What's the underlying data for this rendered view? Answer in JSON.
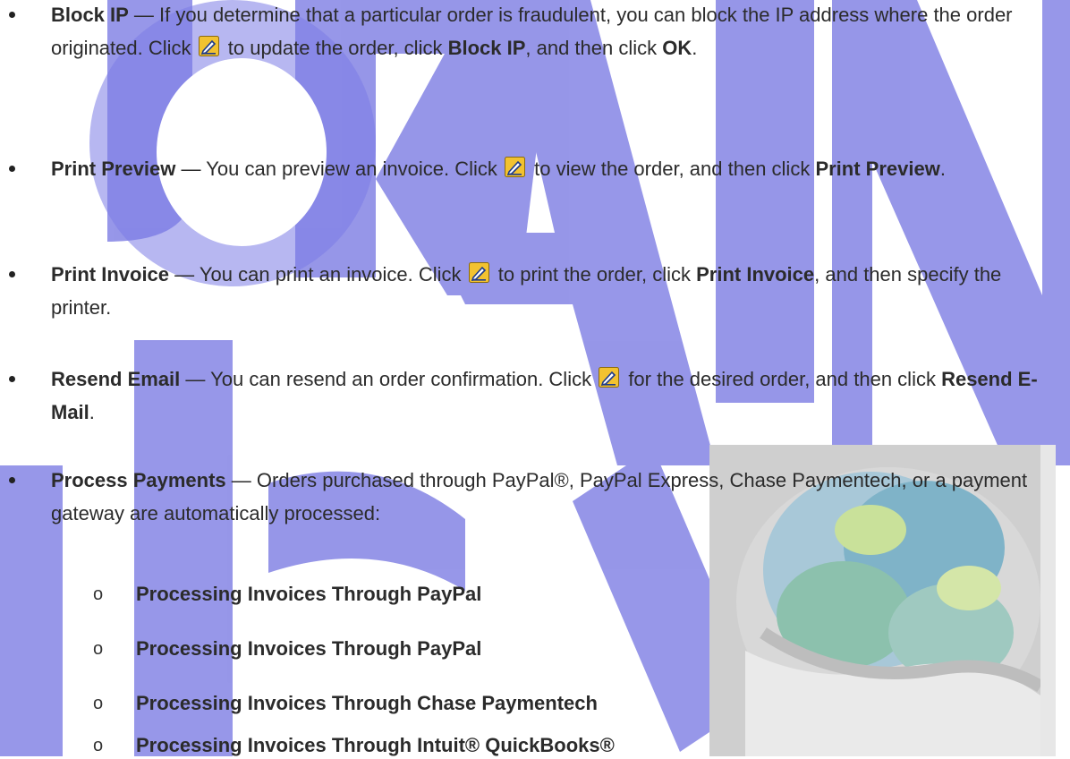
{
  "watermark": {
    "color": "#6666e6"
  },
  "edit_icon": {
    "icon": "pencil-edit-icon",
    "colors": {
      "bg": "#f2c230",
      "border": "#8a6a10",
      "pencil": "#1d3a8a"
    }
  },
  "items": [
    {
      "term": "Block IP",
      "dash": " — ",
      "text_before_icon": "If you determine that a particular order is fraudulent, you can block the IP address where the order originated. Click ",
      "text_after_icon_1": " to update the order, click ",
      "bold_1": "Block IP",
      "text_2": ", and then click ",
      "bold_2": "OK",
      "text_3": "."
    },
    {
      "term": "Print Preview",
      "dash": " — ",
      "text_before_icon": "You can preview an invoice. Click ",
      "text_after_icon_1": " to view the order, and then click ",
      "bold_1": "Print Preview",
      "text_2": "."
    },
    {
      "term": "Print Invoice",
      "dash": " — ",
      "text_before_icon": "You can print an invoice. Click ",
      "text_after_icon_1": " to print the order, click ",
      "bold_1": "Print Invoice",
      "text_2": ", and then specify the printer."
    },
    {
      "term": "Resend Email",
      "dash": " — ",
      "text_before_icon": "You can resend an order confirmation. Click ",
      "text_after_icon_1": " for the desired order, and then click ",
      "bold_1": "Resend E-Mail",
      "text_2": "."
    },
    {
      "term": "Process Payments",
      "dash": " — ",
      "text": "Orders purchased through PayPal®, PayPal Express, Chase Paymentech, or a payment gateway are automatically processed:"
    }
  ],
  "sub_marker": "o",
  "subitems": [
    "Processing Invoices Through PayPal",
    "Processing Invoices Through PayPal",
    "Processing Invoices Through Chase Paymentech",
    "Processing Invoices Through Intuit® QuickBooks®"
  ]
}
